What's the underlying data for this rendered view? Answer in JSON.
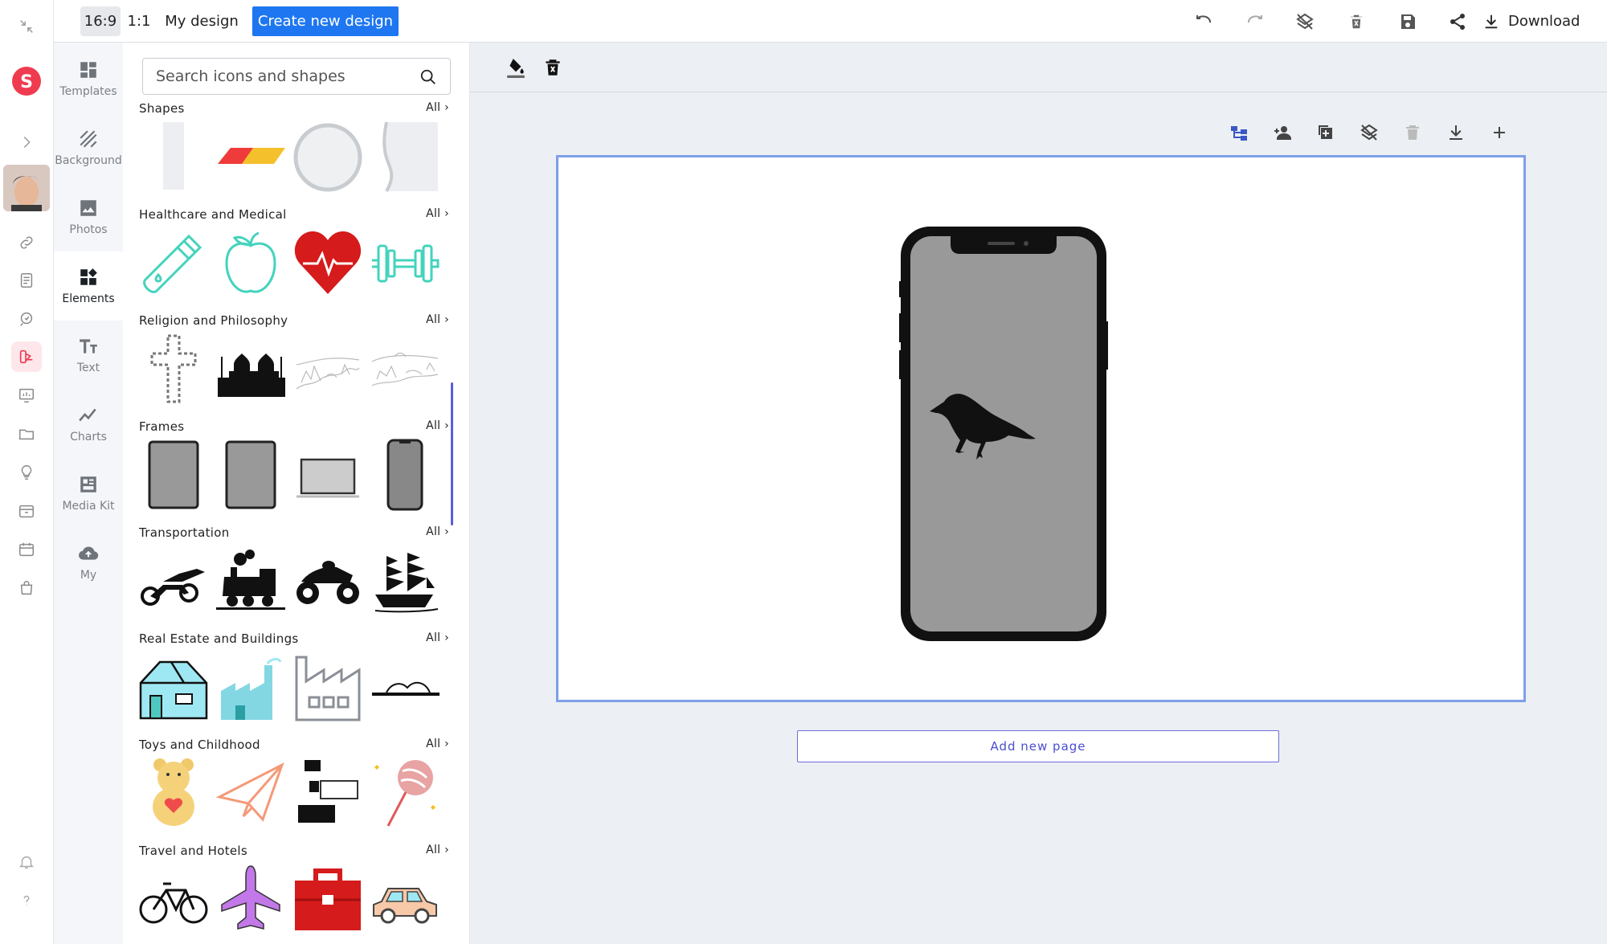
{
  "topbar": {
    "ratio_169": "16:9",
    "ratio_11": "1:1",
    "my_design": "My design",
    "create_new": "Create new design",
    "download": "Download"
  },
  "sidebar": {
    "items": [
      {
        "label": "Templates",
        "icon": "templates-icon"
      },
      {
        "label": "Background",
        "icon": "background-icon"
      },
      {
        "label": "Photos",
        "icon": "photos-icon"
      },
      {
        "label": "Elements",
        "icon": "elements-icon",
        "active": true
      },
      {
        "label": "Text",
        "icon": "text-icon"
      },
      {
        "label": "Charts",
        "icon": "charts-icon"
      },
      {
        "label": "Media Kit",
        "icon": "media-kit-icon"
      },
      {
        "label": "My",
        "icon": "cloud-upload-icon"
      }
    ]
  },
  "search": {
    "placeholder": "Search icons and shapes"
  },
  "categories": [
    {
      "title": "Shapes",
      "all": "All ›"
    },
    {
      "title": "Healthcare and Medical",
      "all": "All ›"
    },
    {
      "title": "Religion and Philosophy",
      "all": "All ›"
    },
    {
      "title": "Frames",
      "all": "All ›"
    },
    {
      "title": "Transportation",
      "all": "All ›"
    },
    {
      "title": "Real Estate and Buildings",
      "all": "All ›"
    },
    {
      "title": "Toys and Childhood",
      "all": "All ›"
    },
    {
      "title": "Travel and Hotels",
      "all": "All ›"
    }
  ],
  "canvas": {
    "add_page": "Add new page"
  },
  "colors": {
    "accent": "#1e77f0",
    "page_border": "#7e9fe8",
    "heart_red": "#d51b1b",
    "mint": "#43d3bd"
  }
}
